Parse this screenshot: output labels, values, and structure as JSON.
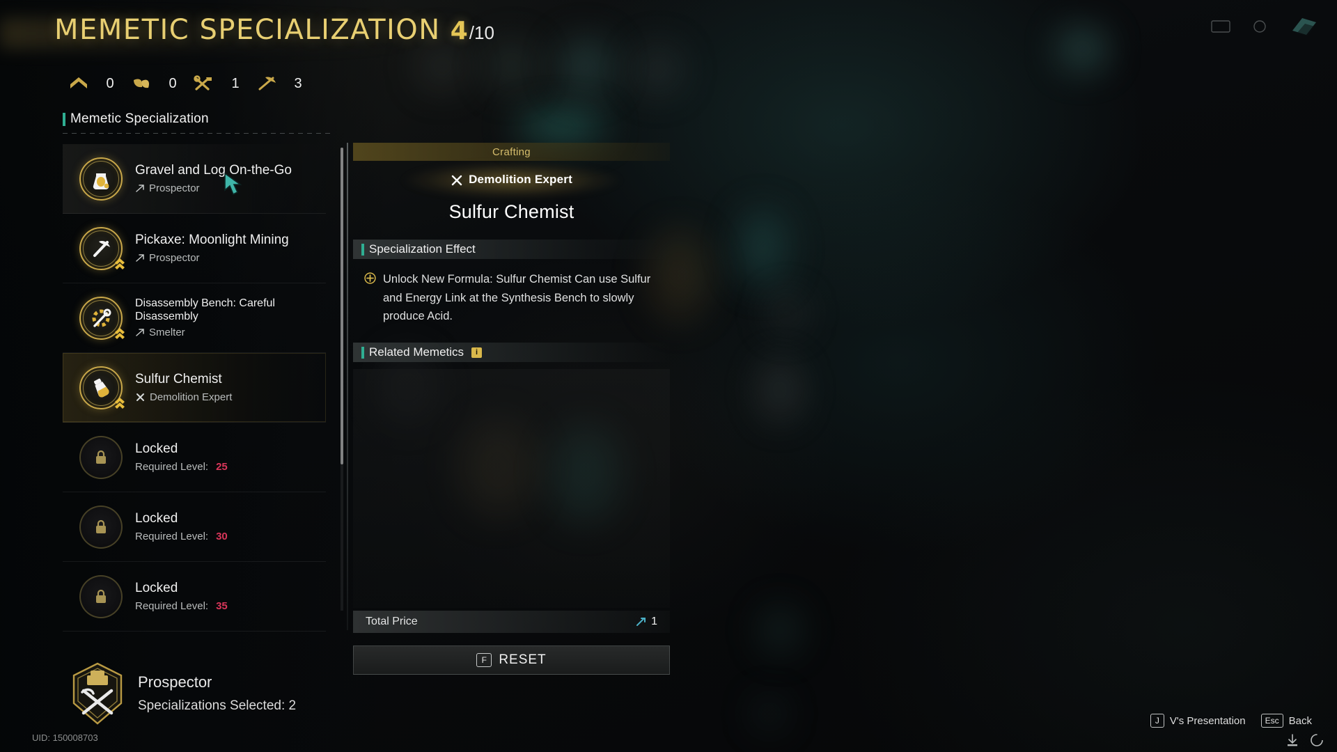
{
  "header": {
    "title": "MEMETIC SPECIALIZATION",
    "count_current": "4",
    "count_max": "/10"
  },
  "resources": [
    {
      "icon": "house-chevron-icon",
      "value": "0"
    },
    {
      "icon": "leaf-icon",
      "value": "0"
    },
    {
      "icon": "wrench-hammer-icon",
      "value": "1"
    },
    {
      "icon": "pickaxe-icon",
      "value": "3"
    }
  ],
  "sidebar": {
    "section_title": "Memetic Specialization",
    "items": [
      {
        "name": "Gravel and Log On-the-Go",
        "sub": "Prospector",
        "sub_icon": "arrow-up-right-icon",
        "state": "hover",
        "icon": "gold-bag-icon",
        "upgraded": false
      },
      {
        "name": "Pickaxe: Moonlight Mining",
        "sub": "Prospector",
        "sub_icon": "arrow-up-right-icon",
        "state": "normal",
        "icon": "pickaxe-medal-icon",
        "upgraded": true
      },
      {
        "name": "Disassembly Bench: Careful Disassembly",
        "sub": "Smelter",
        "sub_icon": "arrow-up-right-icon",
        "state": "normal",
        "icon": "gear-wrench-icon",
        "upgraded": true
      },
      {
        "name": "Sulfur Chemist",
        "sub": "Demolition Expert",
        "sub_icon": "cross-tools-icon",
        "state": "selected",
        "icon": "flask-icon",
        "upgraded": true
      },
      {
        "name": "Locked",
        "sub": "Required Level:",
        "level": "25",
        "state": "locked",
        "icon": "lock-icon"
      },
      {
        "name": "Locked",
        "sub": "Required Level:",
        "level": "30",
        "state": "locked",
        "icon": "lock-icon"
      },
      {
        "name": "Locked",
        "sub": "Required Level:",
        "level": "35",
        "state": "locked",
        "icon": "lock-icon"
      }
    ]
  },
  "detail": {
    "category": "Crafting",
    "discipline": "Demolition Expert",
    "discipline_icon": "cross-tools-icon",
    "title": "Sulfur Chemist",
    "effect_heading": "Specialization Effect",
    "effect_bullet_icon": "plus-circle-icon",
    "effect_text": "Unlock New Formula: Sulfur Chemist Can use Sulfur and Energy Link at the Synthesis Bench to slowly produce Acid.",
    "related_heading": "Related Memetics",
    "related_badge": "i",
    "price_label": "Total Price",
    "price_value": "1",
    "price_icon": "memetic-point-icon",
    "reset_key": "F",
    "reset_label": "RESET"
  },
  "profile": {
    "name": "Prospector",
    "selected_text": "Specializations Selected: 2",
    "uid": "UID: 150008703",
    "medal_icon": "prospector-medal-icon"
  },
  "footer_hints": [
    {
      "key": "J",
      "label": "V's Presentation"
    },
    {
      "key": "Esc",
      "label": "Back"
    }
  ],
  "colors": {
    "gold": "#e8cf72",
    "teal": "#2fae92",
    "locked_level": "#d9365a",
    "panel_gold_bar": "#5c4e1e"
  }
}
